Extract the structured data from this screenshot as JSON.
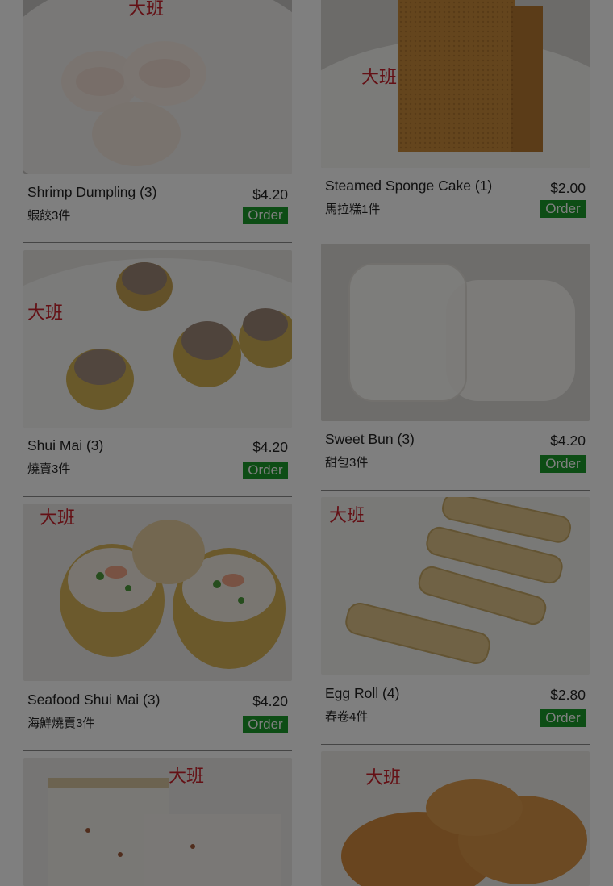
{
  "order_label": "Order",
  "left_items": [
    {
      "name": "Shrimp Dumpling (3)",
      "chinese": "蝦餃3件",
      "price": "$4.20",
      "photo": "shrimp-dumpling-photo"
    },
    {
      "name": "Shui Mai (3)",
      "chinese": "燒賣3件",
      "price": "$4.20",
      "photo": "shui-mai-photo"
    },
    {
      "name": "Seafood Shui Mai (3)",
      "chinese": "海鮮燒賣3件",
      "price": "$4.20",
      "photo": "seafood-shui-mai-photo"
    },
    {
      "photo": "turnip-cake-photo"
    }
  ],
  "right_items": [
    {
      "name": "Steamed Sponge Cake (1)",
      "chinese": "馬拉糕1件",
      "price": "$2.00",
      "photo": "sponge-cake-photo"
    },
    {
      "name": "Sweet Bun (3)",
      "chinese": "甜包3件",
      "price": "$4.20",
      "photo": "sweet-bun-photo"
    },
    {
      "name": "Egg Roll (4)",
      "chinese": "春卷4件",
      "price": "$2.80",
      "photo": "egg-roll-photo"
    },
    {
      "photo": "pastry-cake-photo"
    }
  ],
  "colors": {
    "order_button": "#1a9a2a",
    "overlay": "rgba(0,0,0,0.5)"
  }
}
